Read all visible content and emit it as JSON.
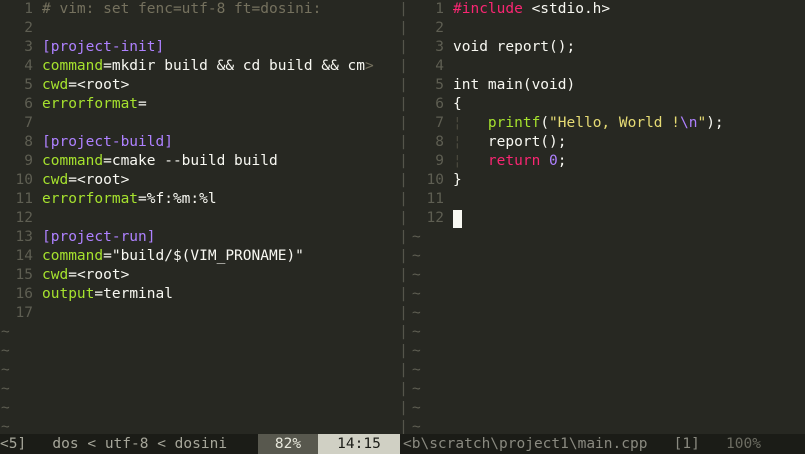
{
  "left_buffer": {
    "lines": [
      {
        "n": "1",
        "tokens": [
          {
            "c": "t-comment",
            "t": "# vim: set fenc=utf-8 ft=dosini:"
          }
        ]
      },
      {
        "n": "2",
        "tokens": []
      },
      {
        "n": "3",
        "tokens": [
          {
            "c": "t-section",
            "t": "[project-init]"
          }
        ]
      },
      {
        "n": "4",
        "tokens": [
          {
            "c": "t-key",
            "t": "command"
          },
          {
            "c": "t-eq",
            "t": "="
          },
          {
            "c": "t-val",
            "t": "mkdir build && cd build && cm"
          }
        ]
      },
      {
        "n": "5",
        "tokens": [
          {
            "c": "t-key",
            "t": "cwd"
          },
          {
            "c": "t-eq",
            "t": "="
          },
          {
            "c": "t-val",
            "t": "<root>"
          }
        ]
      },
      {
        "n": "6",
        "tokens": [
          {
            "c": "t-key",
            "t": "errorformat"
          },
          {
            "c": "t-eq",
            "t": "="
          }
        ]
      },
      {
        "n": "7",
        "tokens": []
      },
      {
        "n": "8",
        "tokens": [
          {
            "c": "t-section",
            "t": "[project-build]"
          }
        ]
      },
      {
        "n": "9",
        "tokens": [
          {
            "c": "t-key",
            "t": "command"
          },
          {
            "c": "t-eq",
            "t": "="
          },
          {
            "c": "t-val",
            "t": "cmake --build build"
          }
        ]
      },
      {
        "n": "10",
        "tokens": [
          {
            "c": "t-key",
            "t": "cwd"
          },
          {
            "c": "t-eq",
            "t": "="
          },
          {
            "c": "t-val",
            "t": "<root>"
          }
        ]
      },
      {
        "n": "11",
        "tokens": [
          {
            "c": "t-key",
            "t": "errorformat"
          },
          {
            "c": "t-eq",
            "t": "="
          },
          {
            "c": "t-val",
            "t": "%f:%m:%l"
          }
        ]
      },
      {
        "n": "12",
        "tokens": []
      },
      {
        "n": "13",
        "tokens": [
          {
            "c": "t-section",
            "t": "[project-run]"
          }
        ]
      },
      {
        "n": "14",
        "tokens": [
          {
            "c": "t-key",
            "t": "command"
          },
          {
            "c": "t-eq",
            "t": "="
          },
          {
            "c": "t-val",
            "t": "\"build/$(VIM_PRONAME)\""
          }
        ]
      },
      {
        "n": "15",
        "tokens": [
          {
            "c": "t-key",
            "t": "cwd"
          },
          {
            "c": "t-eq",
            "t": "="
          },
          {
            "c": "t-val",
            "t": "<root>"
          }
        ]
      },
      {
        "n": "16",
        "tokens": [
          {
            "c": "t-key",
            "t": "output"
          },
          {
            "c": "t-eq",
            "t": "="
          },
          {
            "c": "t-val",
            "t": "terminal"
          }
        ]
      },
      {
        "n": "17",
        "tokens": []
      }
    ],
    "overflow_marker": ">",
    "empty_line_marker": "~",
    "empty_line_count": 6
  },
  "right_buffer": {
    "lines": [
      {
        "n": "1",
        "tokens": [
          {
            "c": "t-pre",
            "t": "#include"
          },
          {
            "c": "t-plain",
            "t": " "
          },
          {
            "c": "t-hdr",
            "t": "<stdio.h>"
          }
        ]
      },
      {
        "n": "2",
        "tokens": []
      },
      {
        "n": "3",
        "tokens": [
          {
            "c": "t-plain",
            "t": "void report();"
          }
        ]
      },
      {
        "n": "4",
        "tokens": []
      },
      {
        "n": "5",
        "tokens": [
          {
            "c": "t-plain",
            "t": "int main(void)"
          }
        ]
      },
      {
        "n": "6",
        "tokens": [
          {
            "c": "t-plain",
            "t": "{"
          }
        ]
      },
      {
        "n": "7",
        "tokens": [
          {
            "c": "indent-guide",
            "t": "¦   "
          },
          {
            "c": "t-fn",
            "t": "printf"
          },
          {
            "c": "t-plain",
            "t": "("
          },
          {
            "c": "t-str",
            "t": "\"Hello, World !"
          },
          {
            "c": "t-esc",
            "t": "\\n"
          },
          {
            "c": "t-str",
            "t": "\""
          },
          {
            "c": "t-plain",
            "t": ");"
          }
        ]
      },
      {
        "n": "8",
        "tokens": [
          {
            "c": "indent-guide",
            "t": "¦   "
          },
          {
            "c": "t-plain",
            "t": "report();"
          }
        ]
      },
      {
        "n": "9",
        "tokens": [
          {
            "c": "indent-guide",
            "t": "¦   "
          },
          {
            "c": "t-kw",
            "t": "return"
          },
          {
            "c": "t-plain",
            "t": " "
          },
          {
            "c": "t-num",
            "t": "0"
          },
          {
            "c": "t-plain",
            "t": ";"
          }
        ]
      },
      {
        "n": "10",
        "tokens": [
          {
            "c": "t-plain",
            "t": "}"
          }
        ]
      },
      {
        "n": "11",
        "tokens": []
      },
      {
        "n": "12",
        "tokens": [],
        "cursor": true
      }
    ],
    "empty_line_marker": "~",
    "empty_line_count": 11
  },
  "statusline": {
    "left_buffer_num": "<5]",
    "fileformat": "dos",
    "encoding": "utf-8",
    "filetype": "dosini",
    "separator": "<",
    "percent": "82%",
    "time": "14:15",
    "right_path": "<b\\scratch\\project1\\main.cpp",
    "right_buffer_num": "[1]",
    "right_percent": "100%"
  },
  "colors": {
    "background": "#272822",
    "statusbar": "#1b1c17",
    "accent_green": "#a6e22e",
    "accent_purple": "#ae81ff",
    "accent_pink": "#f92672",
    "accent_yellow": "#e6db74"
  }
}
